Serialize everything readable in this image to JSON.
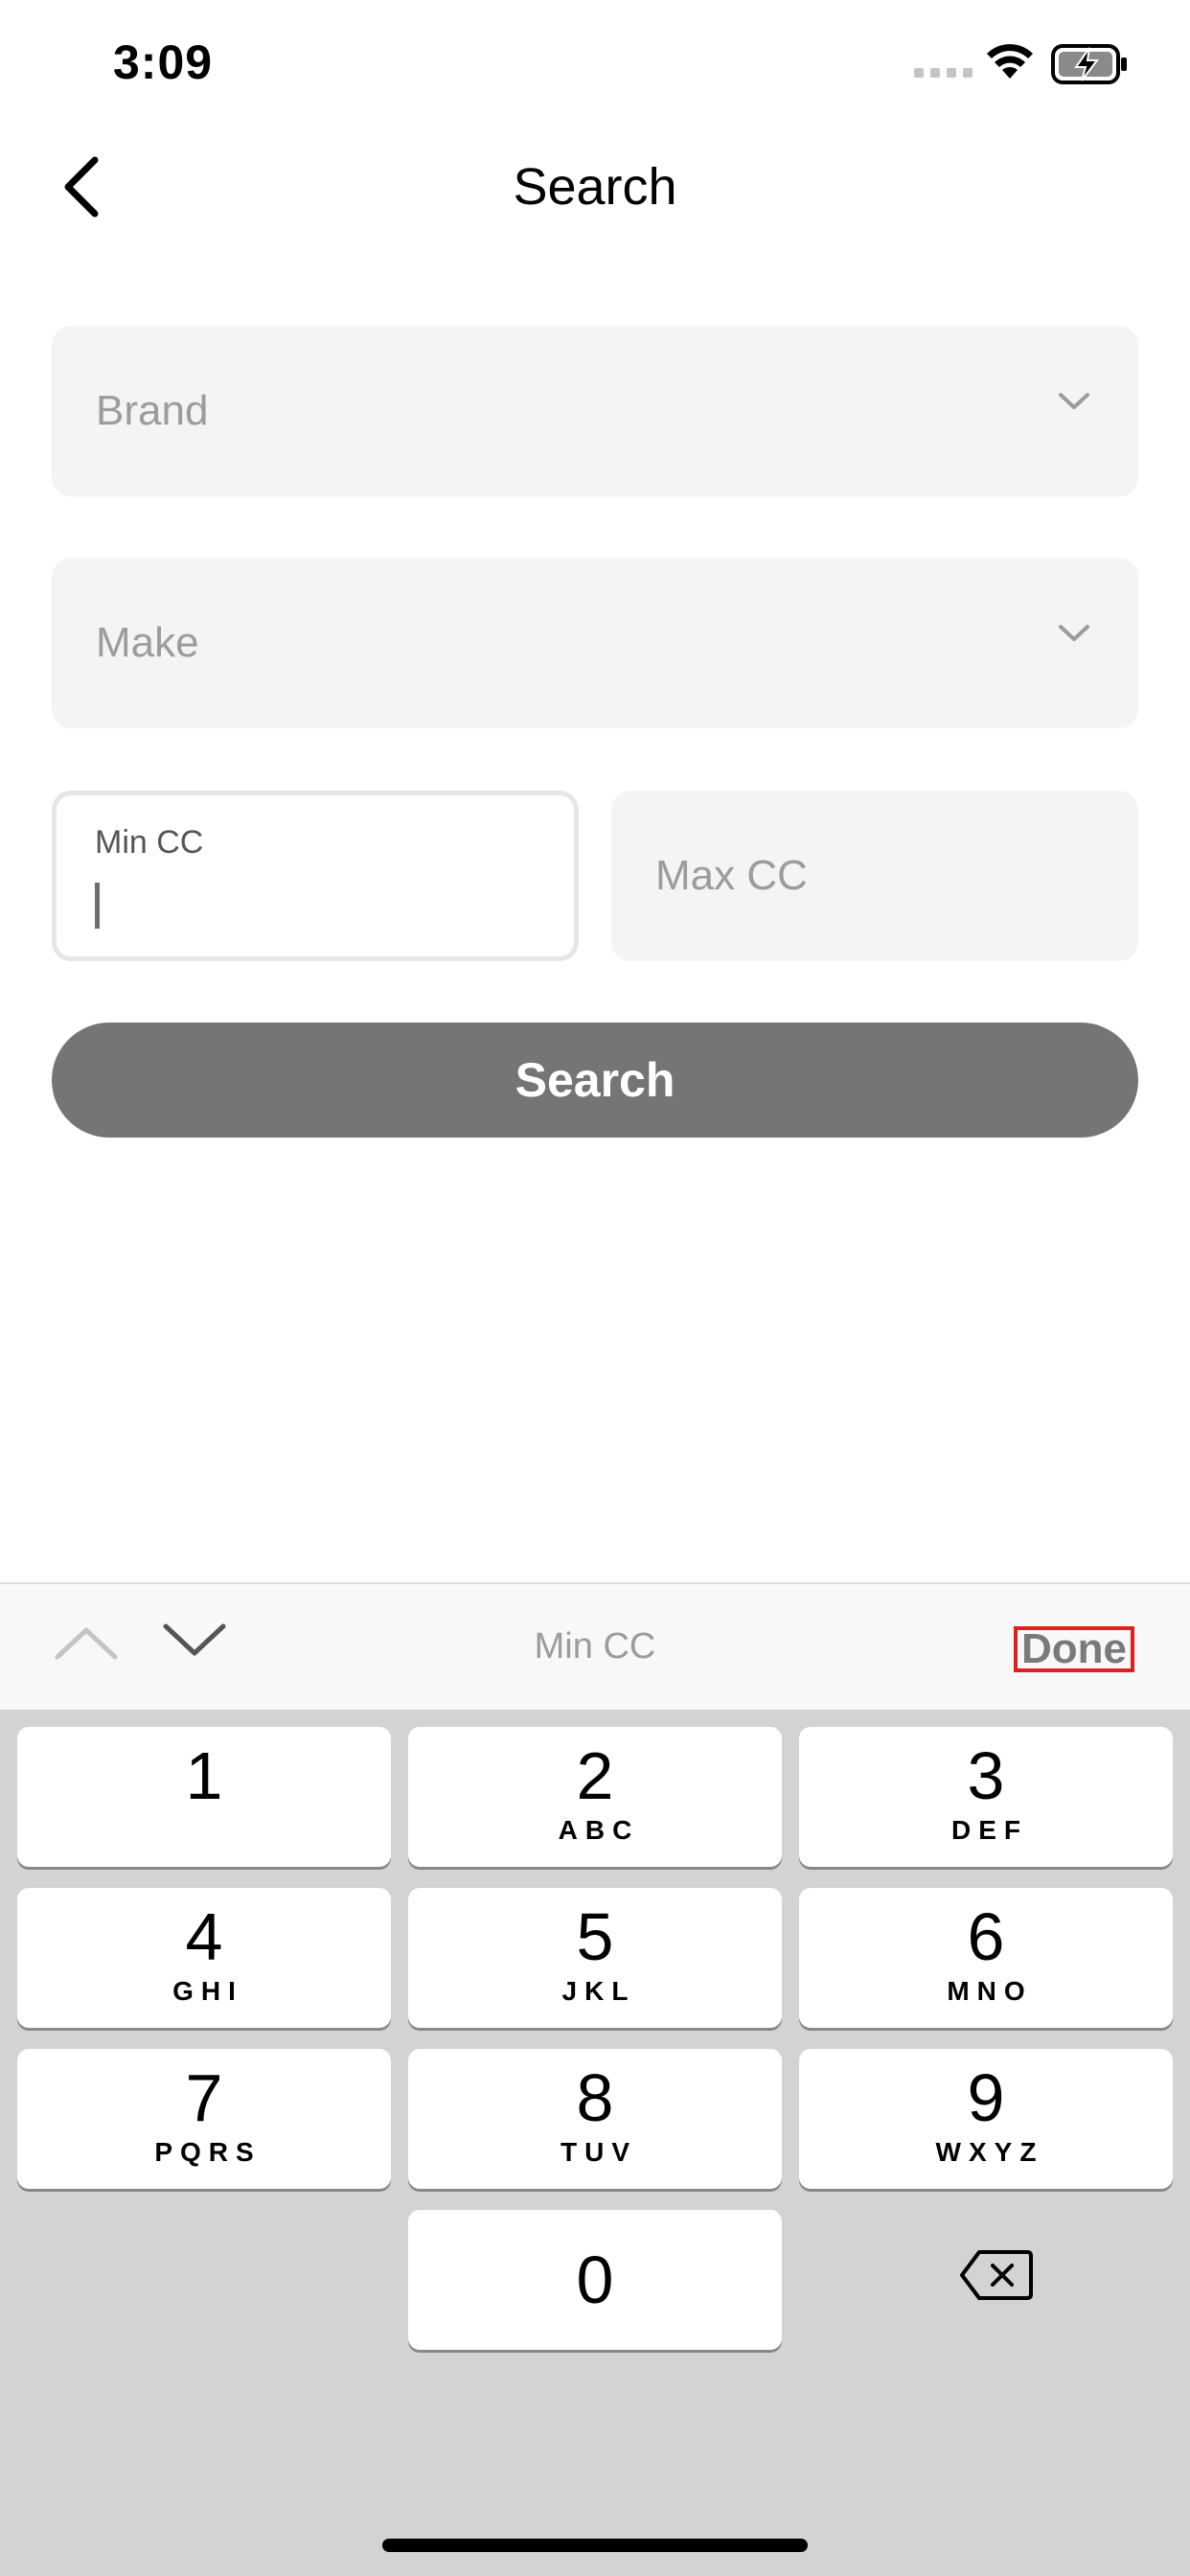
{
  "status_bar": {
    "time": "3:09"
  },
  "nav": {
    "title": "Search"
  },
  "form": {
    "brand_placeholder": "Brand",
    "make_placeholder": "Make",
    "min_cc_label": "Min CC",
    "max_cc_placeholder": "Max CC",
    "search_label": "Search"
  },
  "keyboard_accessory": {
    "field_label": "Min CC",
    "done_label": "Done"
  },
  "keypad": {
    "keys": [
      {
        "digit": "1",
        "letters": ""
      },
      {
        "digit": "2",
        "letters": "ABC"
      },
      {
        "digit": "3",
        "letters": "DEF"
      },
      {
        "digit": "4",
        "letters": "GHI"
      },
      {
        "digit": "5",
        "letters": "JKL"
      },
      {
        "digit": "6",
        "letters": "MNO"
      },
      {
        "digit": "7",
        "letters": "PQRS"
      },
      {
        "digit": "8",
        "letters": "TUV"
      },
      {
        "digit": "9",
        "letters": "WXYZ"
      },
      {
        "digit": "0",
        "letters": ""
      }
    ]
  }
}
